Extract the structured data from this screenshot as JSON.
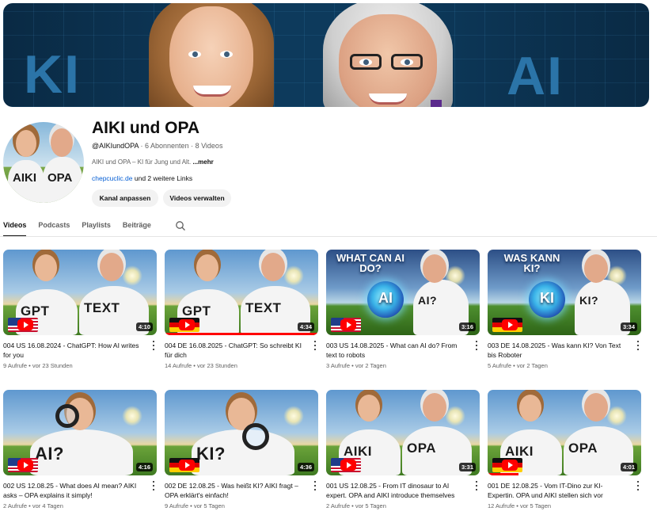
{
  "banner": {
    "left_text": "KI",
    "right_text": "AI"
  },
  "channel": {
    "avatar_left_shirt": "AIKI",
    "avatar_right_shirt": "OPA",
    "title": "AIKI und OPA",
    "handle": "@AIKIundOPA",
    "subscribers": "6 Abonnenten",
    "videos_count": "8 Videos",
    "meta_separator": " · ",
    "description": "AIKI und OPA – KI für Jung und Alt. ",
    "more_label": "...mehr",
    "link_text": "chepcuclic.de",
    "more_links": " und 2 weitere Links",
    "customize_label": "Kanal anpassen",
    "manage_label": "Videos verwalten"
  },
  "tabs": [
    {
      "label": "Videos",
      "active": true
    },
    {
      "label": "Podcasts",
      "active": false
    },
    {
      "label": "Playlists",
      "active": false
    },
    {
      "label": "Beiträge",
      "active": false
    }
  ],
  "videos": [
    {
      "title": "004 US 16.08.2024 - ChatGPT: How AI writes for you",
      "views": "9 Aufrufe",
      "age": "vor 23 Stunden",
      "duration": "4:10",
      "flag": "us",
      "shirt_left": "GPT",
      "shirt_right": "TEXT",
      "progress": 0
    },
    {
      "title": "004 DE 16.08.2025 - ChatGPT: So schreibt KI für dich",
      "views": "14 Aufrufe",
      "age": "vor 23 Stunden",
      "duration": "4:34",
      "flag": "de",
      "shirt_left": "GPT",
      "shirt_right": "TEXT",
      "progress": 1.0
    },
    {
      "title": "003 US 14.08.2025 - What can AI do? From text to robots",
      "views": "3 Aufrufe",
      "age": "vor 2 Tagen",
      "duration": "3:16",
      "flag": "us",
      "overlay": "WHAT CAN AI DO?",
      "globe": "AI",
      "shirt_right": "AI?",
      "progress": 0
    },
    {
      "title": "003 DE 14.08.2025 - Was kann KI? Von Text bis Roboter",
      "views": "5 Aufrufe",
      "age": "vor 2 Tagen",
      "duration": "3:34",
      "flag": "de",
      "overlay": "WAS KANN KI?",
      "globe": "KI",
      "shirt_right": "KI?",
      "progress": 0
    },
    {
      "title": "002 US 12.08.25 - What does AI mean? AIKI asks – OPA explains it simply!",
      "views": "2 Aufrufe",
      "age": "vor 4 Tagen",
      "duration": "4:16",
      "flag": "us",
      "shirt_left": "AI?",
      "progress": 0
    },
    {
      "title": "002 DE 12.08.25 - Was heißt KI? AIKI fragt – OPA erklärt's einfach!",
      "views": "9 Aufrufe",
      "age": "vor 5 Tagen",
      "duration": "4:36",
      "flag": "de",
      "shirt_left": "KI?",
      "progress": 0
    },
    {
      "title": "001 US 12.08.25 - From IT dinosaur to AI expert. OPA and AIKI introduce themselves",
      "views": "2 Aufrufe",
      "age": "vor 5 Tagen",
      "duration": "3:31",
      "flag": "us",
      "shirt_left": "AIKI",
      "shirt_right": "OPA",
      "progress": 0
    },
    {
      "title": "001 DE 12.08.25 - Vom IT-Dino zur KI-Expertin. OPA und AIKI stellen sich vor",
      "views": "12 Aufrufe",
      "age": "vor 5 Tagen",
      "duration": "4:01",
      "flag": "de",
      "shirt_left": "AIKI",
      "shirt_right": "OPA",
      "progress": 0.2
    }
  ],
  "meta_separator": " • "
}
